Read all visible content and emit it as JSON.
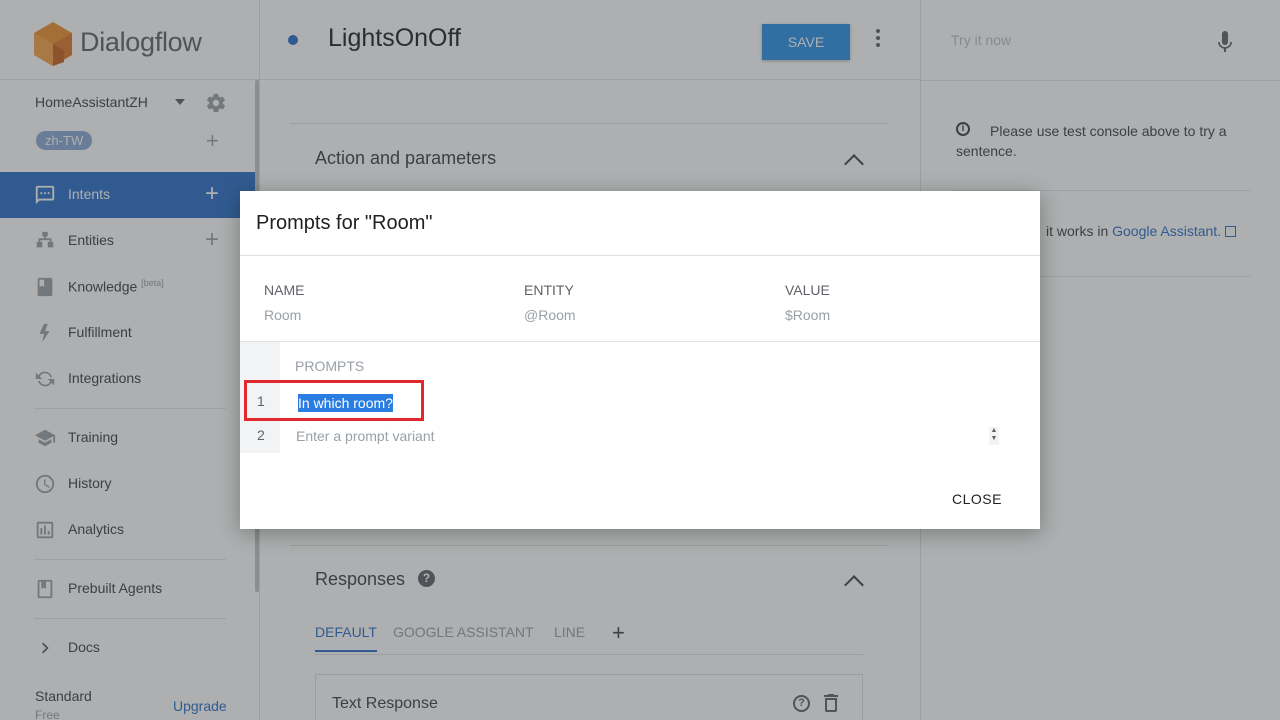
{
  "brand": {
    "name": "Dialogflow"
  },
  "agent": {
    "name": "HomeAssistantZH",
    "language": "zh-TW"
  },
  "nav": {
    "intents": "Intents",
    "entities": "Entities",
    "knowledge": "Knowledge",
    "knowledge_badge": "[beta]",
    "fulfillment": "Fulfillment",
    "integrations": "Integrations",
    "training": "Training",
    "history": "History",
    "analytics": "Analytics",
    "prebuilt": "Prebuilt Agents",
    "docs": "Docs"
  },
  "plan": {
    "name": "Standard",
    "tier": "Free",
    "upgrade": "Upgrade"
  },
  "intent": {
    "title": "LightsOnOff",
    "save_label": "SAVE"
  },
  "sections": {
    "action_params": "Action and parameters",
    "responses": "Responses",
    "response_tabs": [
      "DEFAULT",
      "GOOGLE ASSISTANT",
      "LINE"
    ],
    "text_response": "Text Response"
  },
  "console": {
    "try_placeholder": "Try it now",
    "info": "Please use test console above to try a sentence.",
    "assistant_prefix": "it works in",
    "assistant_link": "Google Assistant."
  },
  "dialog": {
    "title": "Prompts for \"Room\"",
    "columns": {
      "name": "NAME",
      "entity": "ENTITY",
      "value": "VALUE"
    },
    "param": {
      "name": "Room",
      "entity": "@Room",
      "value": "$Room"
    },
    "prompts_label": "PROMPTS",
    "rows": [
      "1",
      "2"
    ],
    "prompt_1": "In which room?",
    "prompt_placeholder": "Enter a prompt variant",
    "close_label": "CLOSE"
  },
  "colors": {
    "accent": "#2a6fc9",
    "save": "#2a8fe6",
    "highlight": "#e0282f"
  }
}
